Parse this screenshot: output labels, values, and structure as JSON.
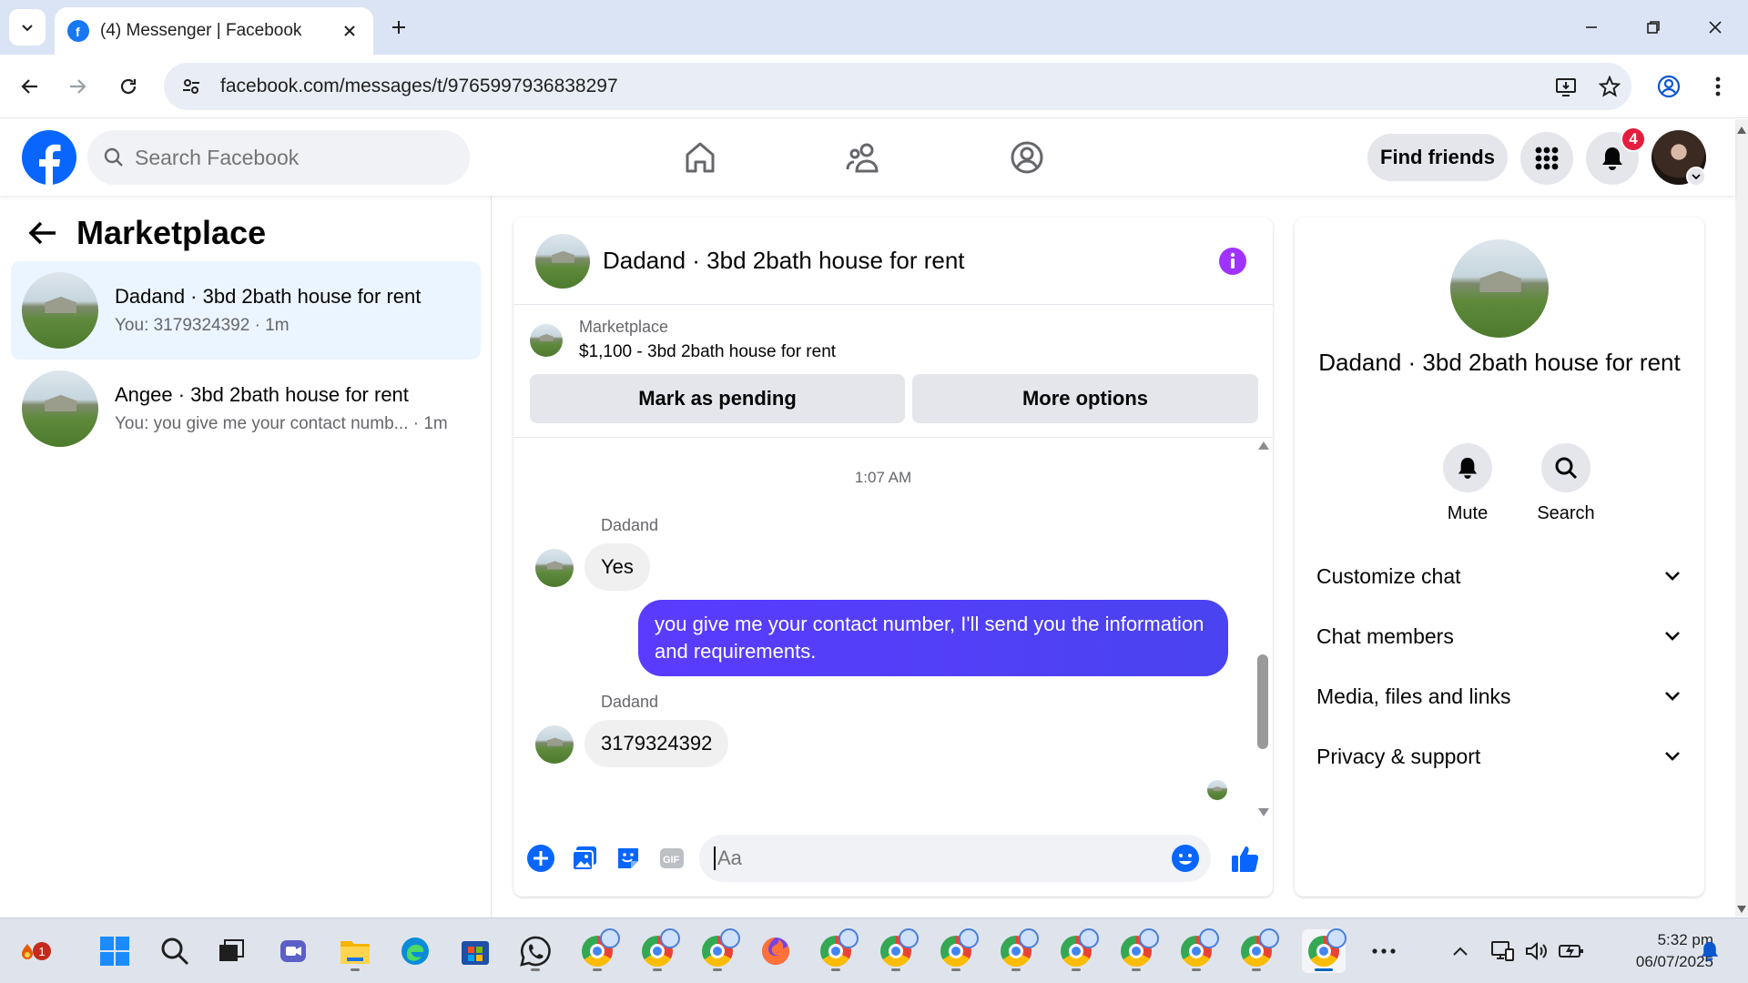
{
  "browser": {
    "tab_title": "(4) Messenger | Facebook",
    "url": "facebook.com/messages/t/9765997936838297"
  },
  "header": {
    "search_placeholder": "Search Facebook",
    "find_friends_label": "Find friends",
    "notification_count": "4"
  },
  "sidebar": {
    "title": "Marketplace",
    "conversations": [
      {
        "name": "Dadand · 3bd 2bath house for rent",
        "preview": "You: 3179324392 · 1m",
        "active": true
      },
      {
        "name": "Angee · 3bd 2bath house for rent",
        "preview": "You: you give me your contact numb...  · 1m",
        "active": false
      }
    ]
  },
  "chat": {
    "title": "Dadand · 3bd 2bath house for rent",
    "listing": {
      "label": "Marketplace",
      "title": "$1,100 - 3bd 2bath house for rent",
      "mark_pending_label": "Mark as pending",
      "more_options_label": "More options"
    },
    "time_separator": "1:07 AM",
    "messages": [
      {
        "sender": "Dadand",
        "text": "Yes",
        "direction": "in"
      },
      {
        "sender": "",
        "text": "you give me your contact number, I'll send you the information and requirements.",
        "direction": "out"
      },
      {
        "sender": "Dadand",
        "text": "3179324392",
        "direction": "in"
      }
    ],
    "composer_placeholder": "Aa"
  },
  "info_panel": {
    "name": "Dadand · 3bd 2bath house for rent",
    "mute_label": "Mute",
    "search_label": "Search",
    "sections": [
      "Customize chat",
      "Chat members",
      "Media, files and links",
      "Privacy & support"
    ]
  },
  "taskbar": {
    "time": "5:32 pm",
    "date": "06/07/2025",
    "weather_badge": "1"
  },
  "colors": {
    "facebook_blue": "#0866ff",
    "outgoing_bubble": "#5b3cff",
    "messenger_purple": "#a033ff",
    "notification_red": "#e41e3f"
  }
}
